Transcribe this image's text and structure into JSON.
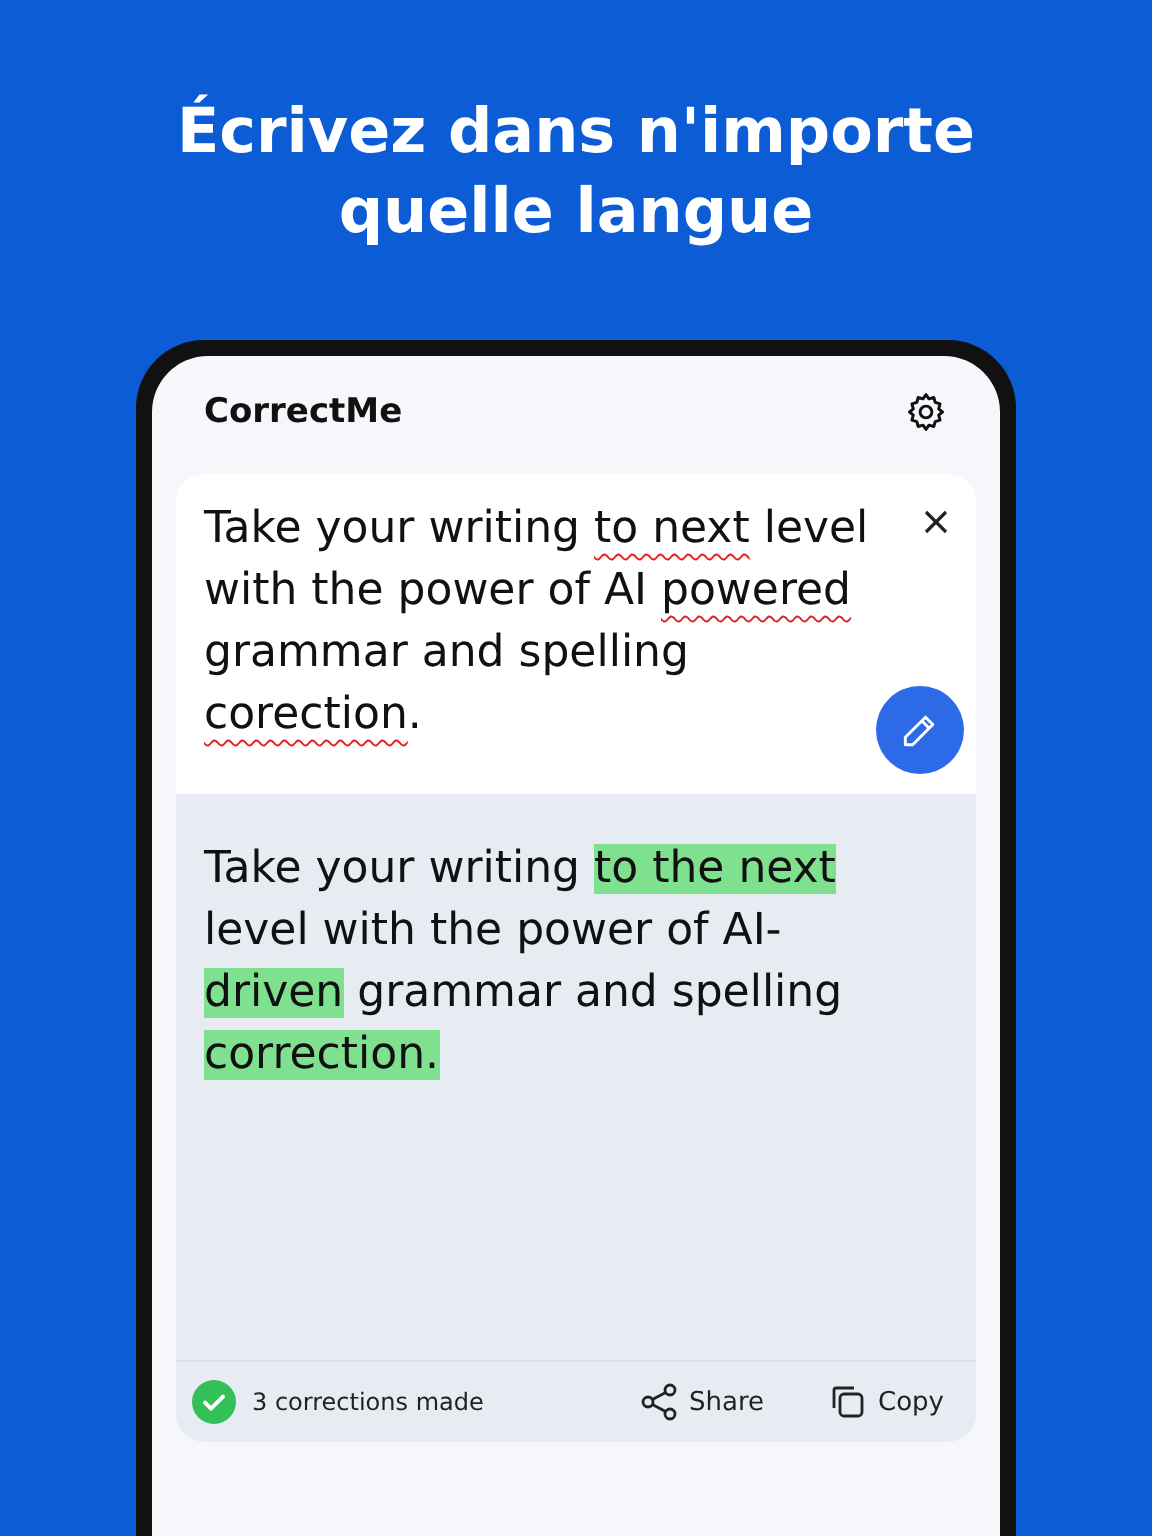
{
  "headline": "Écrivez dans n'importe quelle langue",
  "app": {
    "title": "CorrectMe"
  },
  "input": {
    "segments": [
      {
        "text": "Take your writing ",
        "error": false
      },
      {
        "text": "to next",
        "error": true
      },
      {
        "text": " level with the power of AI ",
        "error": false
      },
      {
        "text": "powered",
        "error": true
      },
      {
        "text": " grammar and spelling ",
        "error": false
      },
      {
        "text": "corection",
        "error": true
      },
      {
        "text": ".",
        "error": false
      }
    ]
  },
  "output": {
    "segments": [
      {
        "text": "Take your writing ",
        "changed": false
      },
      {
        "text": "to the next",
        "changed": true
      },
      {
        "text": " level with the power of AI-",
        "changed": false
      },
      {
        "text": "driven",
        "changed": true
      },
      {
        "text": " grammar and spelling ",
        "changed": false
      },
      {
        "text": "correction.",
        "changed": true
      }
    ]
  },
  "footer": {
    "status": "3 corrections made",
    "actions": [
      {
        "label": "Share",
        "kind": "share"
      },
      {
        "label": "Copy",
        "kind": "copy"
      }
    ]
  }
}
